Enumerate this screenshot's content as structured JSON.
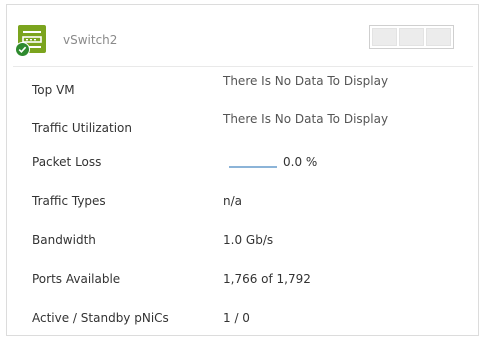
{
  "header": {
    "title": "vSwitch2",
    "icon": "virtual-switch-icon",
    "status_icon": "check-badge-icon",
    "accent": "#7ba41e"
  },
  "rows": [
    {
      "label": "Top VM",
      "value": "There Is No Data To Display"
    },
    {
      "label": "Traffic Utilization",
      "value": "There Is No Data To Display"
    },
    {
      "label": "Packet Loss",
      "value": "0.0 %"
    },
    {
      "label": "Traffic Types",
      "value": "n/a"
    },
    {
      "label": "Bandwidth",
      "value": "1.0 Gb/s"
    },
    {
      "label": "Ports Available",
      "value": "1,766 of 1,792"
    },
    {
      "label": "Active / Standby pNiCs",
      "value": "1 / 0"
    }
  ]
}
